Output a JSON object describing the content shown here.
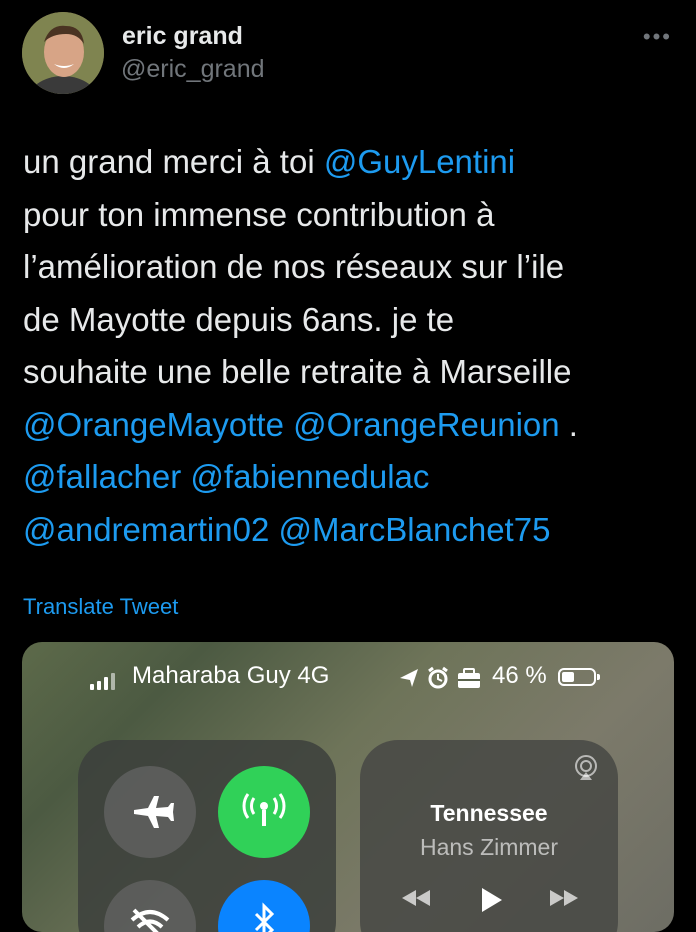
{
  "author": {
    "name": "eric grand",
    "handle": "@eric_grand"
  },
  "more_label": "•••",
  "tweet_lines": [
    [
      {
        "text": "un grand merci à toi ",
        "mention": false
      },
      {
        "text": "@GuyLentini",
        "mention": true
      }
    ],
    [
      {
        "text": "pour ton immense contribution à",
        "mention": false
      }
    ],
    [
      {
        "text": "l’amélioration de nos réseaux sur l’ile",
        "mention": false
      }
    ],
    [
      {
        "text": "de Mayotte depuis 6ans. je te",
        "mention": false
      }
    ],
    [
      {
        "text": "souhaite une belle retraite à Marseille",
        "mention": false
      }
    ],
    [
      {
        "text": "@OrangeMayotte",
        "mention": true
      },
      {
        "text": " ",
        "mention": false
      },
      {
        "text": "@OrangeReunion",
        "mention": true
      },
      {
        "text": " .",
        "mention": false
      }
    ],
    [
      {
        "text": "@fallacher",
        "mention": true
      },
      {
        "text": " ",
        "mention": false
      },
      {
        "text": "@fabiennedulac",
        "mention": true
      }
    ],
    [
      {
        "text": "@andremartin02",
        "mention": true
      },
      {
        "text": " ",
        "mention": false
      },
      {
        "text": "@MarcBlanchet75",
        "mention": true
      }
    ]
  ],
  "translate_label": "Translate Tweet",
  "media": {
    "carrier": "Maharaba Guy 4G",
    "battery_percent_label": "46 %",
    "battery_level": 0.46,
    "now_playing": {
      "title": "Tennessee",
      "artist": "Hans Zimmer"
    },
    "icons": [
      "location-arrow-icon",
      "alarm-icon",
      "briefcase-icon",
      "airplane-icon",
      "cellular-antenna-icon",
      "wifi-icon",
      "bluetooth-icon",
      "airplay-icon"
    ]
  },
  "colors": {
    "background": "#000000",
    "text": "#e7e9ea",
    "secondary": "#71767b",
    "link": "#1d9bf0",
    "cellular_green": "#30d158",
    "bluetooth_blue": "#0a84ff"
  }
}
